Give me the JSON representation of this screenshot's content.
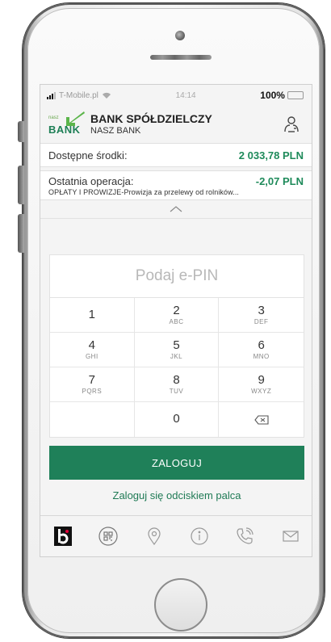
{
  "status_bar": {
    "carrier": "T-Mobile.pl",
    "time": "14:14",
    "battery": "100%"
  },
  "header": {
    "logo_small": "nasz",
    "logo_big": "BANK",
    "bank_title": "BANK SPÓŁDZIELCZY",
    "bank_subtitle": "NASZ BANK"
  },
  "balance": {
    "label": "Dostępne środki:",
    "value": "2 033,78 PLN"
  },
  "last_operation": {
    "label": "Ostatnia operacja:",
    "value": "-2,07 PLN",
    "description": "OPŁATY I PROWIZJE-Prowizja za przelewy od rolników..."
  },
  "pin": {
    "placeholder": "Podaj e-PIN"
  },
  "keypad": [
    {
      "num": "1",
      "letters": ""
    },
    {
      "num": "2",
      "letters": "ABC"
    },
    {
      "num": "3",
      "letters": "DEF"
    },
    {
      "num": "4",
      "letters": "GHI"
    },
    {
      "num": "5",
      "letters": "JKL"
    },
    {
      "num": "6",
      "letters": "MNO"
    },
    {
      "num": "7",
      "letters": "PQRS"
    },
    {
      "num": "8",
      "letters": "TUV"
    },
    {
      "num": "9",
      "letters": "WXYZ"
    },
    {
      "num": "",
      "letters": ""
    },
    {
      "num": "0",
      "letters": ""
    }
  ],
  "login_button": "ZALOGUJ",
  "fingerprint_link": "Zaloguj się odciskiem palca",
  "nav_icons": [
    "blik-icon",
    "qr-code-icon",
    "location-pin-icon",
    "info-icon",
    "phone-icon",
    "mail-icon"
  ],
  "colors": {
    "primary_green": "#1f8059",
    "amount_green": "#1e8a5a"
  }
}
